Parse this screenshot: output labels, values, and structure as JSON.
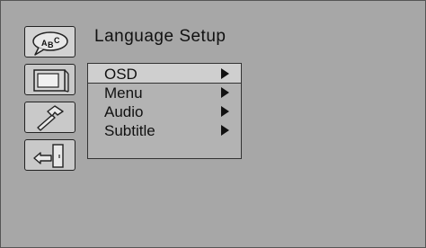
{
  "page": {
    "title": "Language Setup"
  },
  "side_icons": [
    {
      "icon": "language-bubble-icon",
      "label": "ABC"
    },
    {
      "icon": "tv-monitor-icon"
    },
    {
      "icon": "hammer-tool-icon"
    },
    {
      "icon": "exit-door-icon"
    }
  ],
  "menu": {
    "items": [
      {
        "label": "OSD",
        "arrow": "right-triangle-icon",
        "selected": true
      },
      {
        "label": "Menu",
        "arrow": "right-triangle-icon"
      },
      {
        "label": "Audio",
        "arrow": "right-triangle-icon"
      },
      {
        "label": "Subtitle",
        "arrow": "right-triangle-icon"
      }
    ]
  }
}
